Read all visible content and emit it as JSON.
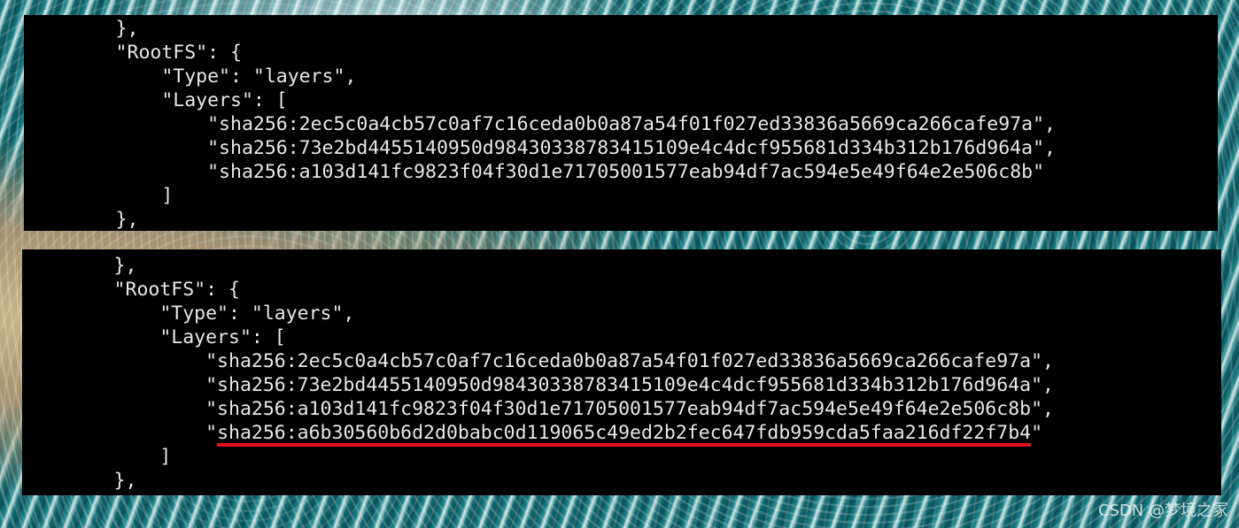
{
  "terminal_top": {
    "lines": [
      "        },",
      "        \"RootFS\": {",
      "            \"Type\": \"layers\",",
      "            \"Layers\": [",
      "                \"sha256:2ec5c0a4cb57c0af7c16ceda0b0a87a54f01f027ed33836a5669ca266cafe97a\",",
      "                \"sha256:73e2bd4455140950d98430338783415109e4c4dcf955681d334b312b176d964a\",",
      "                \"sha256:a103d141fc9823f04f30d1e71705001577eab94df7ac594e5e49f64e2e506c8b\"",
      "            ]",
      "        },"
    ]
  },
  "terminal_bottom": {
    "lines": [
      "        },",
      "        \"RootFS\": {",
      "            \"Type\": \"layers\",",
      "            \"Layers\": [",
      "                \"sha256:2ec5c0a4cb57c0af7c16ceda0b0a87a54f01f027ed33836a5669ca266cafe97a\",",
      "                \"sha256:73e2bd4455140950d98430338783415109e4c4dcf955681d334b312b176d964a\",",
      "                \"sha256:a103d141fc9823f04f30d1e71705001577eab94df7ac594e5e49f64e2e506c8b\","
    ],
    "new_layer_prefix": "                \"",
    "new_layer": "sha256:a6b30560b6d2d0babc0d119065c49ed2b2fec647fdb959cda5faa216df22f7b4",
    "new_layer_suffix": "\"",
    "closing_lines": [
      "            ]",
      "        },"
    ]
  },
  "highlight_color": "#e0101c",
  "watermark": "CSDN @梦境之冢"
}
